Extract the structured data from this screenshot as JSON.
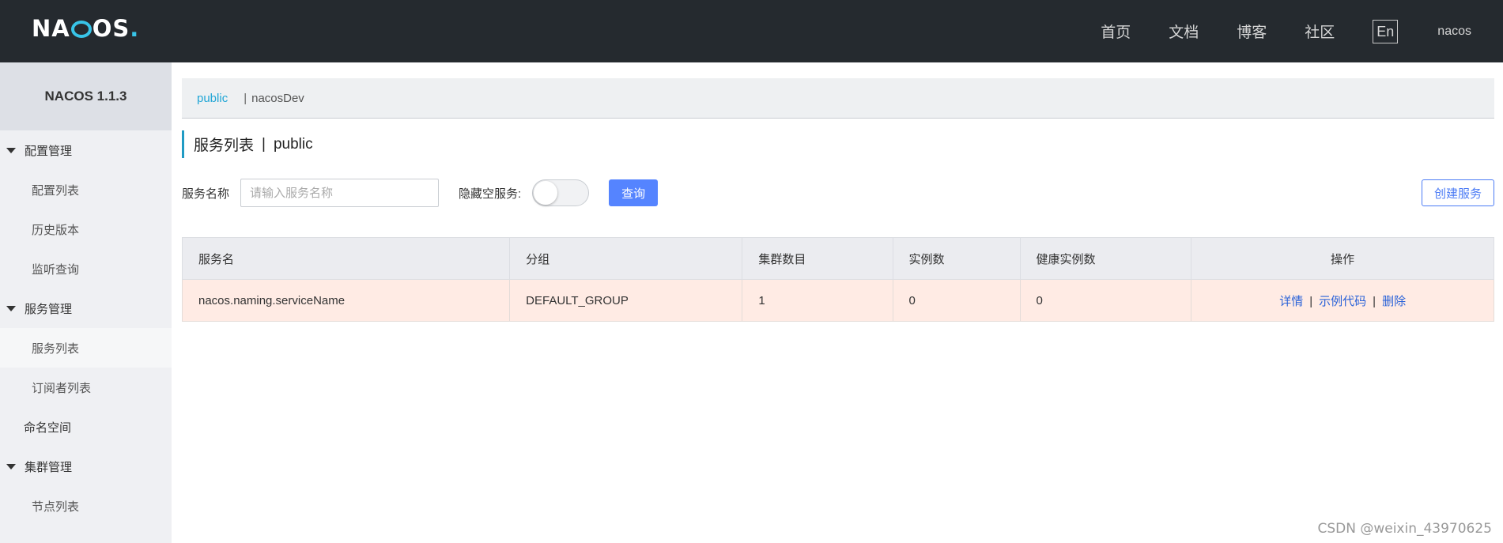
{
  "topbar": {
    "logo_prefix": "NA",
    "logo_suffix": "OS",
    "logo_dot": ".",
    "nav": [
      "首页",
      "文档",
      "博客",
      "社区"
    ],
    "lang": "En",
    "user": "nacos"
  },
  "sidebar": {
    "version": "NACOS 1.1.3",
    "config_group": "配置管理",
    "config_items": [
      "配置列表",
      "历史版本",
      "监听查询"
    ],
    "service_group": "服务管理",
    "service_items": [
      "服务列表",
      "订阅者列表"
    ],
    "namespace": "命名空间",
    "cluster_group": "集群管理",
    "cluster_items": [
      "节点列表"
    ]
  },
  "namespace_bar": {
    "active": "public",
    "separator": "|",
    "other": "nacosDev"
  },
  "page": {
    "title": "服务列表",
    "title_sep": "|",
    "title_ns": "public"
  },
  "filter": {
    "service_name_label": "服务名称",
    "service_name_placeholder": "请输入服务名称",
    "service_name_value": "",
    "hide_empty_label": "隐藏空服务:",
    "hide_empty_on": false,
    "query_button": "查询",
    "create_button": "创建服务"
  },
  "table": {
    "columns": [
      "服务名",
      "分组",
      "集群数目",
      "实例数",
      "健康实例数",
      "操作"
    ],
    "rows": [
      {
        "name": "nacos.naming.serviceName",
        "group": "DEFAULT_GROUP",
        "clusters": "1",
        "instances": "0",
        "healthy": "0",
        "ops": [
          "详情",
          "示例代码",
          "删除"
        ],
        "op_sep": "|"
      }
    ]
  },
  "watermark": "CSDN @weixin_43970625",
  "colors": {
    "topbar_bg": "#252a2f",
    "accent": "#21a6d6",
    "primary_button": "#5584ff",
    "row_highlight": "#ffebe4"
  }
}
